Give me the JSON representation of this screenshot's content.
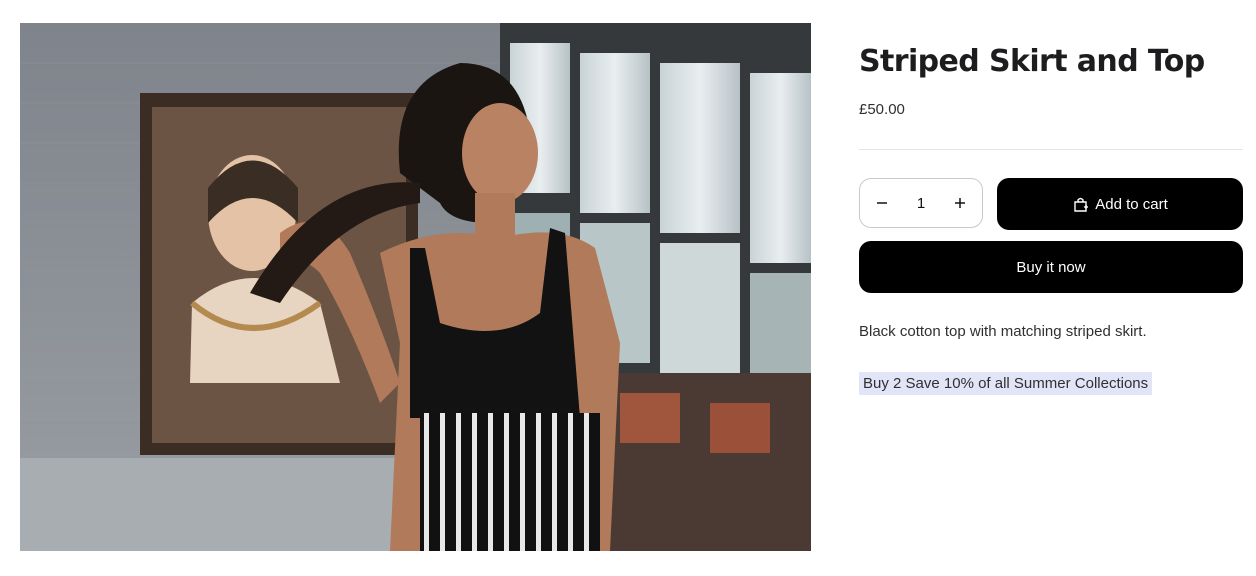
{
  "product": {
    "image_alt": "Woman wearing a black cotton top and black-and-white striped skirt in front of a framed portrait",
    "title": "Striped Skirt and Top",
    "price": "£50.00",
    "quantity": "1",
    "description": "Black cotton top with matching striped skirt.",
    "promo": "Buy 2 Save 10% of all Summer Collections"
  },
  "buttons": {
    "add_to_cart": "Add to cart",
    "buy_now": "Buy it now",
    "decrease_icon": "minus-icon",
    "increase_icon": "plus-icon",
    "cart_icon": "shopping-bag-icon"
  },
  "colors": {
    "button_bg": "#000000",
    "button_text": "#ffffff",
    "promo_highlight": "#e1e5f7"
  }
}
